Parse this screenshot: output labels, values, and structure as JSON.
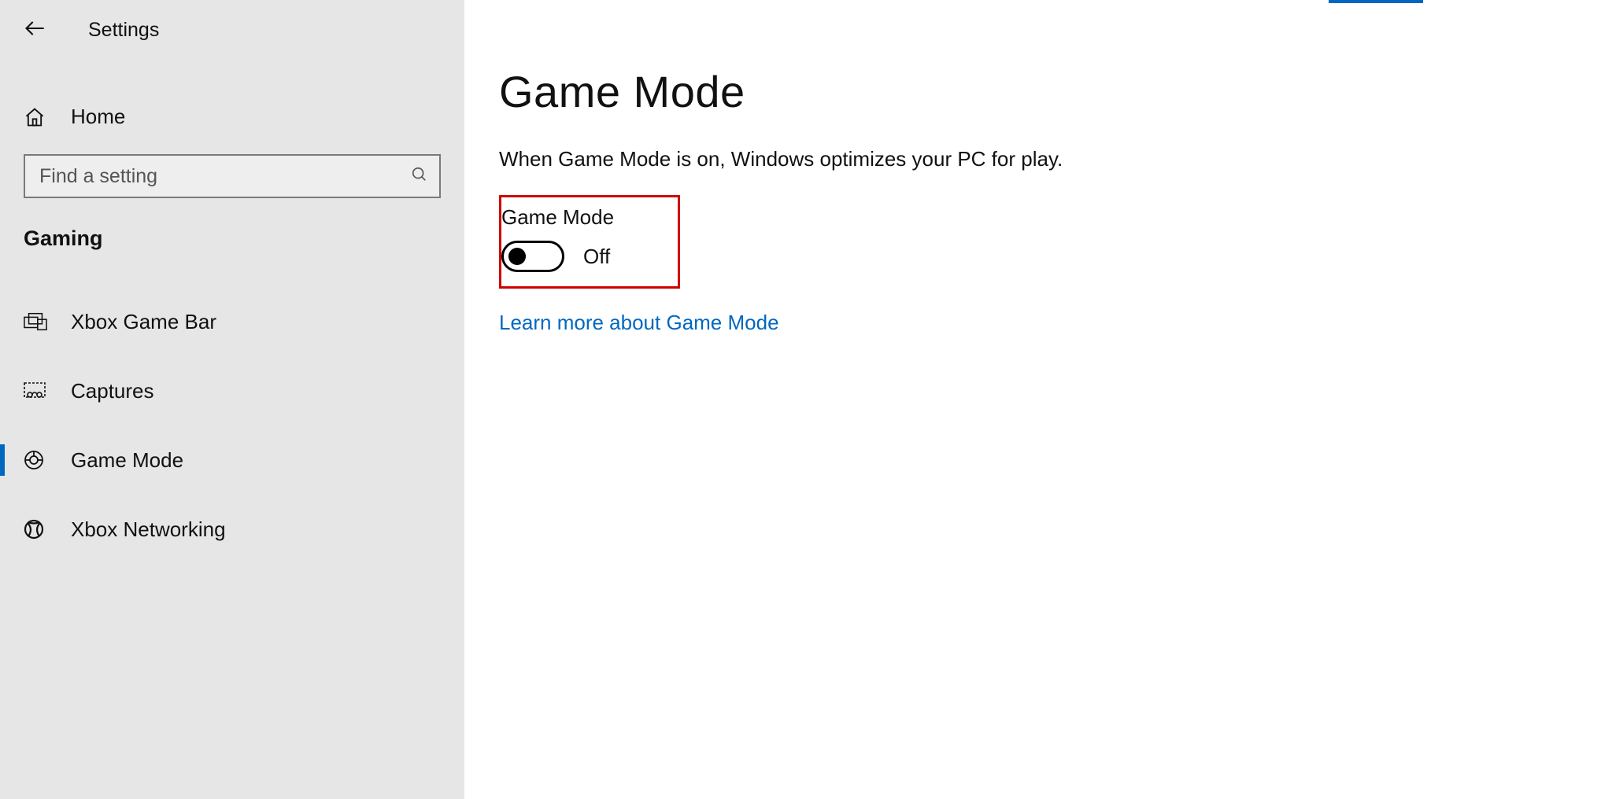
{
  "header": {
    "title": "Settings"
  },
  "sidebar": {
    "home_label": "Home",
    "search_placeholder": "Find a setting",
    "category": "Gaming",
    "items": [
      {
        "label": "Xbox Game Bar",
        "selected": false
      },
      {
        "label": "Captures",
        "selected": false
      },
      {
        "label": "Game Mode",
        "selected": true
      },
      {
        "label": "Xbox Networking",
        "selected": false
      }
    ]
  },
  "main": {
    "heading": "Game Mode",
    "description": "When Game Mode is on, Windows optimizes your PC for play.",
    "toggle": {
      "label": "Game Mode",
      "state": "Off",
      "on": false,
      "highlighted": true
    },
    "learn_more": "Learn more about Game Mode"
  },
  "colors": {
    "accent": "#0067c0",
    "highlight_border": "#d10000",
    "sidebar_bg": "#e6e6e6"
  }
}
